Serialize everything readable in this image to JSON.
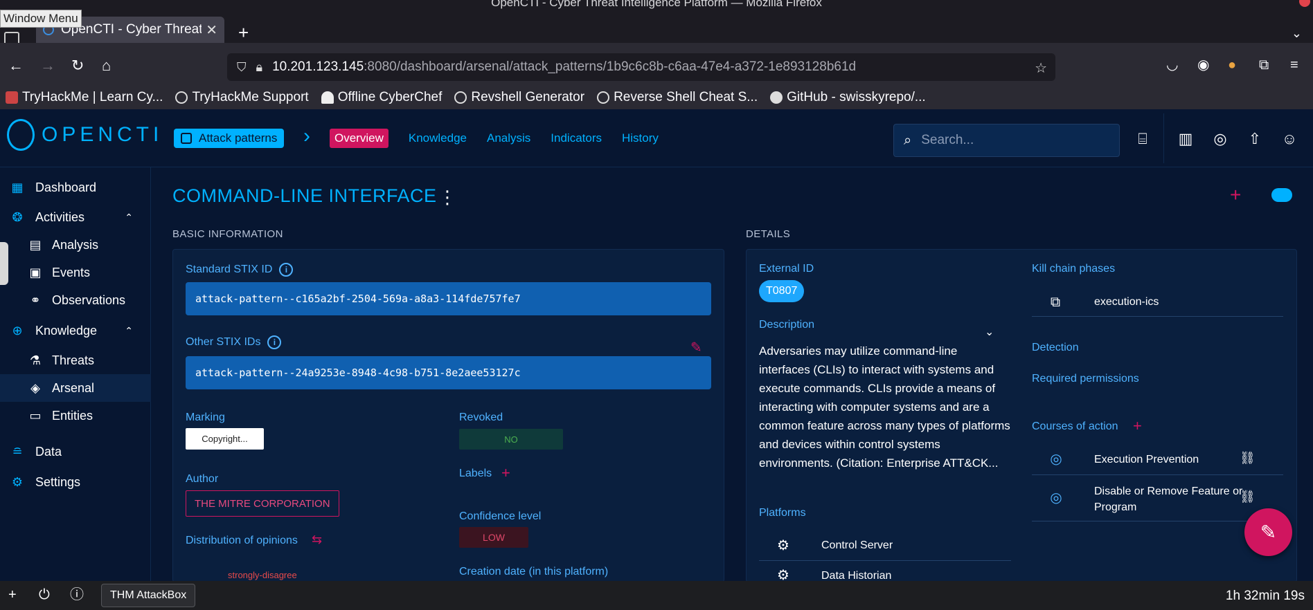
{
  "window": {
    "title": "OpenCTI - Cyber Threat Intelligence Platform — Mozilla Firefox",
    "menu_tooltip": "Window Menu"
  },
  "browser": {
    "tab_title": "OpenCTI - Cyber Threat Ir",
    "url_host": "10.201.123.145",
    "url_path": ":8080/dashboard/arsenal/attack_patterns/1b9c6c8b-c6aa-47e4-a372-1e893128b61d",
    "bookmarks": [
      "TryHackMe | Learn Cy...",
      "TryHackMe Support",
      "Offline CyberChef",
      "Revshell Generator",
      "Reverse Shell Cheat S...",
      "GitHub - swisskyrepo/..."
    ]
  },
  "app": {
    "logo": "OPENCTI",
    "breadcrumb": "Attack patterns",
    "nav": {
      "overview": "Overview",
      "knowledge": "Knowledge",
      "analysis": "Analysis",
      "indicators": "Indicators",
      "history": "History"
    },
    "search_placeholder": "Search..."
  },
  "sidebar": {
    "dashboard": "Dashboard",
    "activities": "Activities",
    "analysis": "Analysis",
    "events": "Events",
    "observations": "Observations",
    "knowledge": "Knowledge",
    "threats": "Threats",
    "arsenal": "Arsenal",
    "entities": "Entities",
    "data": "Data",
    "settings": "Settings"
  },
  "entity": {
    "title": "COMMAND-LINE INTERFACE",
    "basic_header": "BASIC INFORMATION",
    "details_header": "DETAILS",
    "std_stix_label": "Standard STIX ID",
    "std_stix_value": "attack-pattern--c165a2bf-2504-569a-a8a3-114fde757fe7",
    "other_stix_label": "Other STIX IDs",
    "other_stix_value": "attack-pattern--24a9253e-8948-4c98-b751-8e2aee53127c",
    "marking_label": "Marking",
    "marking_value": "Copyright...",
    "revoked_label": "Revoked",
    "revoked_value": "NO",
    "labels_label": "Labels",
    "author_label": "Author",
    "author_value": "THE MITRE CORPORATION",
    "confidence_label": "Confidence level",
    "confidence_value": "LOW",
    "opinions_label": "Distribution of opinions",
    "opinion_value": "strongly-disagree",
    "creation_label": "Creation date (in this platform)",
    "external_id_label": "External ID",
    "external_id_value": "T0807",
    "description_label": "Description",
    "description_text": "Adversaries may utilize command-line interfaces (CLIs) to interact with systems and execute commands. CLIs provide a means of interacting with computer systems and are a common feature across many types of platforms and devices within control systems environments. (Citation: Enterprise ATT&CK...",
    "platforms_label": "Platforms",
    "platforms": [
      "Control Server",
      "Data Historian"
    ],
    "kill_chain_label": "Kill chain phases",
    "kill_chain_value": "execution-ics",
    "detection_label": "Detection",
    "permissions_label": "Required permissions",
    "coa_label": "Courses of action",
    "coa": [
      "Execution Prevention",
      "Disable or Remove Feature or Program"
    ]
  },
  "taskbar": {
    "app_label": "THM AttackBox",
    "timer": "1h 32min 19s"
  }
}
